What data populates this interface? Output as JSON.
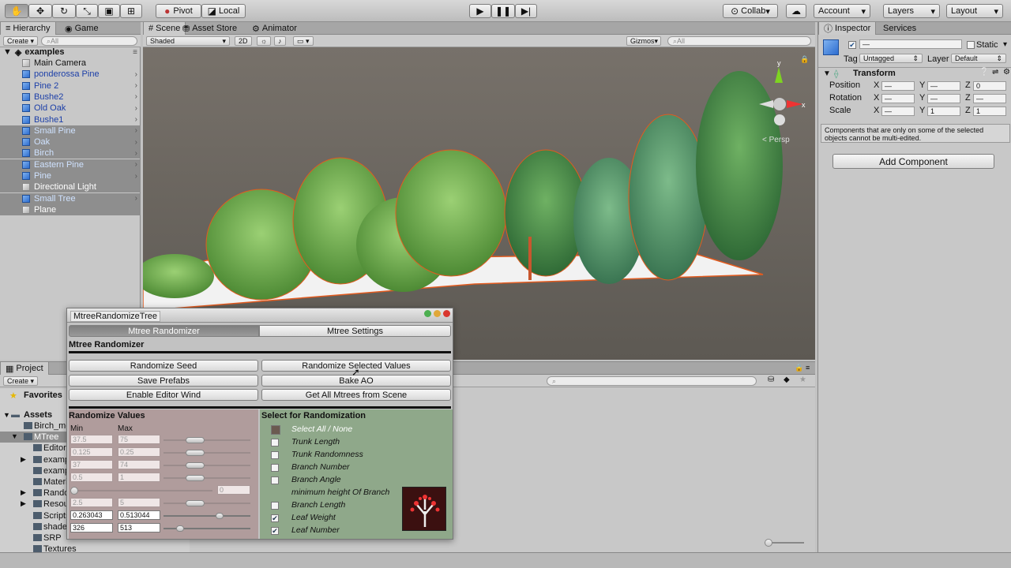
{
  "toolbar": {
    "pivot": "Pivot",
    "local": "Local",
    "collab": "Collab",
    "account": "Account",
    "layers": "Layers",
    "layout": "Layout"
  },
  "hierarchy": {
    "tab": "Hierarchy",
    "tab2": "Game",
    "create": "Create",
    "search_placeholder": "All",
    "scene_name": "examples",
    "items": [
      {
        "label": "Main Camera",
        "type": "gray",
        "selected": false
      },
      {
        "label": "ponderossa Pine",
        "type": "prefab",
        "selected": false
      },
      {
        "label": "Pine 2",
        "type": "prefab",
        "selected": false
      },
      {
        "label": "Bushe2",
        "type": "prefab",
        "selected": false
      },
      {
        "label": "Old Oak",
        "type": "prefab",
        "selected": false
      },
      {
        "label": "Bushe1",
        "type": "prefab",
        "selected": false
      },
      {
        "label": "Small Pine",
        "type": "prefab",
        "selected": true
      },
      {
        "label": "Oak",
        "type": "prefab",
        "selected": true
      },
      {
        "label": "Birch",
        "type": "prefab",
        "selected": true
      },
      {
        "label": "Eastern Pine",
        "type": "prefab",
        "selected": true
      },
      {
        "label": "Pine",
        "type": "prefab",
        "selected": true
      },
      {
        "label": "Directional Light",
        "type": "gray",
        "selected": true
      },
      {
        "label": "Small Tree",
        "type": "prefab",
        "selected": true
      },
      {
        "label": "Plane",
        "type": "gray",
        "selected": true
      }
    ]
  },
  "scene": {
    "tabs": [
      "Scene",
      "Asset Store",
      "Animator"
    ],
    "shading": "Shaded",
    "mode2d": "2D",
    "gizmos": "Gizmos",
    "search_placeholder": "All",
    "persp": "< Persp",
    "axes": {
      "x": "x",
      "y": "y"
    }
  },
  "inspector": {
    "tabs": [
      "Inspector",
      "Services"
    ],
    "static": "Static",
    "tag_label": "Tag",
    "tag_value": "Untagged",
    "layer_label": "Layer",
    "layer_value": "Default",
    "transform": "Transform",
    "position": "Position",
    "rotation": "Rotation",
    "scale": "Scale",
    "x": "X",
    "y": "Y",
    "z": "Z",
    "pos_vals": [
      "—",
      "—",
      "0"
    ],
    "rot_vals": [
      "—",
      "—",
      "—"
    ],
    "scale_vals": [
      "—",
      "1",
      "1"
    ],
    "note": "Components that are only on some of the selected objects cannot be multi-edited.",
    "add_component": "Add Component"
  },
  "project": {
    "tab": "Project",
    "create": "Create",
    "favorites": "Favorites",
    "assets": "Assets",
    "tree": [
      "Birch_me",
      "MTree",
      "Editor",
      "examp",
      "examp",
      "Materi",
      "Rando",
      "Resou",
      "Scripts",
      "shade",
      "SRP",
      "Textures"
    ]
  },
  "mtree": {
    "title": "MtreeRandomizeTree",
    "tab_randomizer": "Mtree Randomizer",
    "tab_settings": "Mtree Settings",
    "heading": "Mtree Randomizer",
    "buttons": {
      "randomize_seed": "Randomize Seed",
      "randomize_selected": "Randomize Selected Values",
      "save_prefabs": "Save Prefabs",
      "bake_ao": "Bake AO",
      "enable_wind": "Enable Editor Wind",
      "get_all": "Get All Mtrees from Scene"
    },
    "values_heading": "Randomize Values",
    "min": "Min",
    "max": "Max",
    "rows": [
      {
        "min": "37.5",
        "max": "75",
        "active": false
      },
      {
        "min": "0.125",
        "max": "0.25",
        "active": false
      },
      {
        "min": "37",
        "max": "74",
        "active": false
      },
      {
        "min": "0.5",
        "max": "1",
        "active": false
      },
      {
        "min": "",
        "max": "0",
        "active": false
      },
      {
        "min": "2.5",
        "max": "5",
        "active": false
      },
      {
        "min": "0.263043",
        "max": "0.513044",
        "active": true
      },
      {
        "min": "326",
        "max": "513",
        "active": true
      }
    ],
    "select_heading": "Select for Randomization",
    "options": [
      {
        "label": "Select All / None",
        "checked": false,
        "box": true
      },
      {
        "label": "Trunk Length",
        "checked": false,
        "box": true
      },
      {
        "label": "Trunk Randomness",
        "checked": false,
        "box": true
      },
      {
        "label": "Branch Number",
        "checked": false,
        "box": true
      },
      {
        "label": "Branch Angle",
        "checked": false,
        "box": true
      },
      {
        "label": "minimum height Of Branch",
        "checked": false,
        "box": false
      },
      {
        "label": "Branch Length",
        "checked": false,
        "box": true
      },
      {
        "label": "Leaf Weight",
        "checked": true,
        "box": true
      },
      {
        "label": "Leaf Number",
        "checked": true,
        "box": true
      }
    ]
  }
}
